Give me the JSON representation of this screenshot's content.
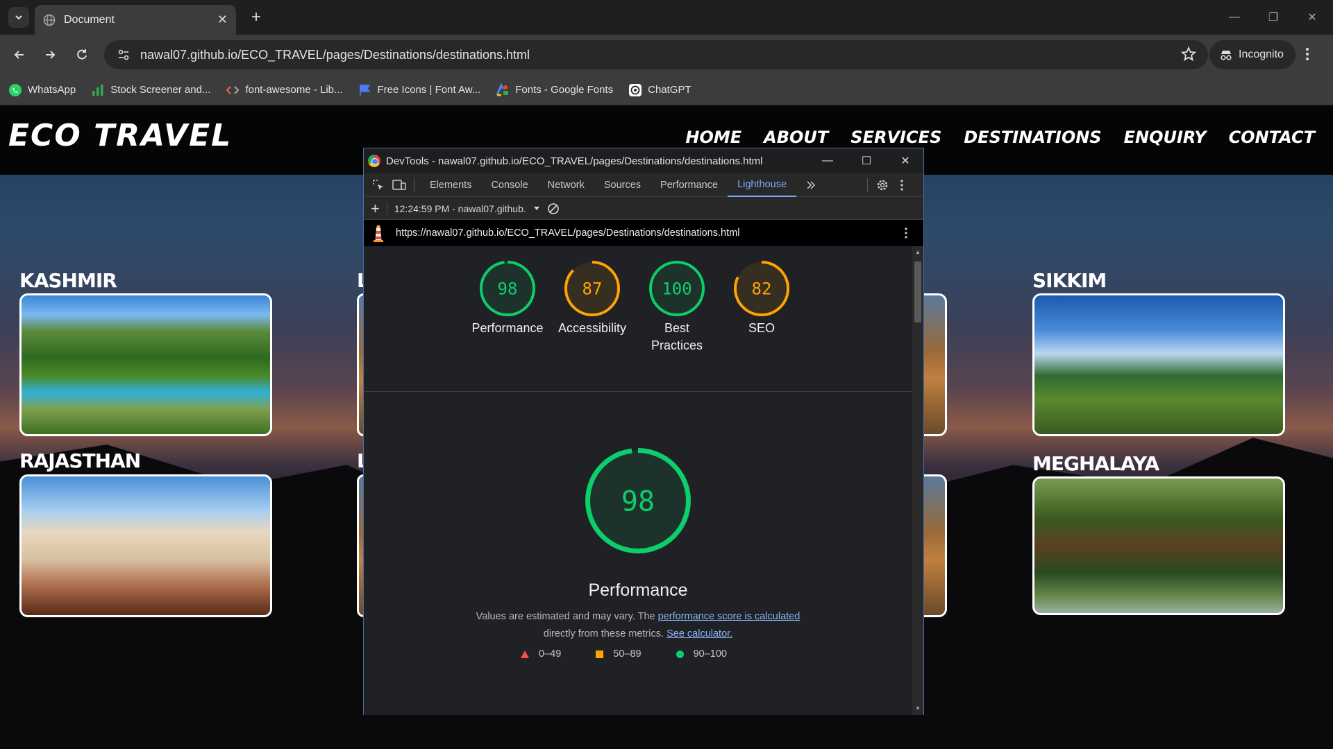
{
  "browser": {
    "tab_title": "Document",
    "url": "nawal07.github.io/ECO_TRAVEL/pages/Destinations/destinations.html",
    "incognito_label": "Incognito",
    "bookmarks": [
      {
        "label": "WhatsApp",
        "icon": "whatsapp-icon"
      },
      {
        "label": "Stock Screener and...",
        "icon": "bar-chart-icon"
      },
      {
        "label": "font-awesome - Lib...",
        "icon": "code-icon"
      },
      {
        "label": "Free Icons | Font Aw...",
        "icon": "flag-icon"
      },
      {
        "label": "Fonts - Google Fonts",
        "icon": "google-fonts-icon"
      },
      {
        "label": "ChatGPT",
        "icon": "chatgpt-icon"
      }
    ]
  },
  "site": {
    "brand": "ECO TRAVEL",
    "nav": [
      "HOME",
      "ABOUT",
      "SERVICES",
      "DESTINATIONS",
      "ENQUIRY",
      "CONTACT"
    ],
    "destinations": {
      "kashmir": "KASHMIR",
      "rajasthan": "RAJASTHAN",
      "sikkim": "SIKKIM",
      "meghalaya": "MEGHALAYA",
      "partial_left_1": "L",
      "partial_left_2": "L"
    }
  },
  "devtools": {
    "window_title": "DevTools - nawal07.github.io/ECO_TRAVEL/pages/Destinations/destinations.html",
    "tabs": [
      "Elements",
      "Console",
      "Network",
      "Sources",
      "Performance",
      "Lighthouse"
    ],
    "active_tab": "Lighthouse",
    "report_selector": "12:24:59 PM - nawal07.github.",
    "report_url": "https://nawal07.github.io/ECO_TRAVEL/pages/Destinations/destinations.html",
    "scores": [
      {
        "label": "Performance",
        "value": 98,
        "color": "#0cce6b"
      },
      {
        "label": "Accessibility",
        "value": 87,
        "color": "#ffa400"
      },
      {
        "label": "Best Practices",
        "value": 100,
        "color": "#0cce6b"
      },
      {
        "label": "SEO",
        "value": 82,
        "color": "#ffa400"
      }
    ],
    "main_score": {
      "label": "Performance",
      "value": 98,
      "color": "#0cce6b"
    },
    "desc_prefix": "Values are estimated and may vary. The",
    "desc_link1": "performance score is calculated",
    "desc_mid": "directly from these metrics.",
    "desc_link2": "See calculator.",
    "legend": [
      {
        "label": "0–49",
        "color": "#ff4e42"
      },
      {
        "label": "50–89",
        "color": "#ffa400"
      },
      {
        "label": "90–100",
        "color": "#0cce6b"
      }
    ]
  }
}
